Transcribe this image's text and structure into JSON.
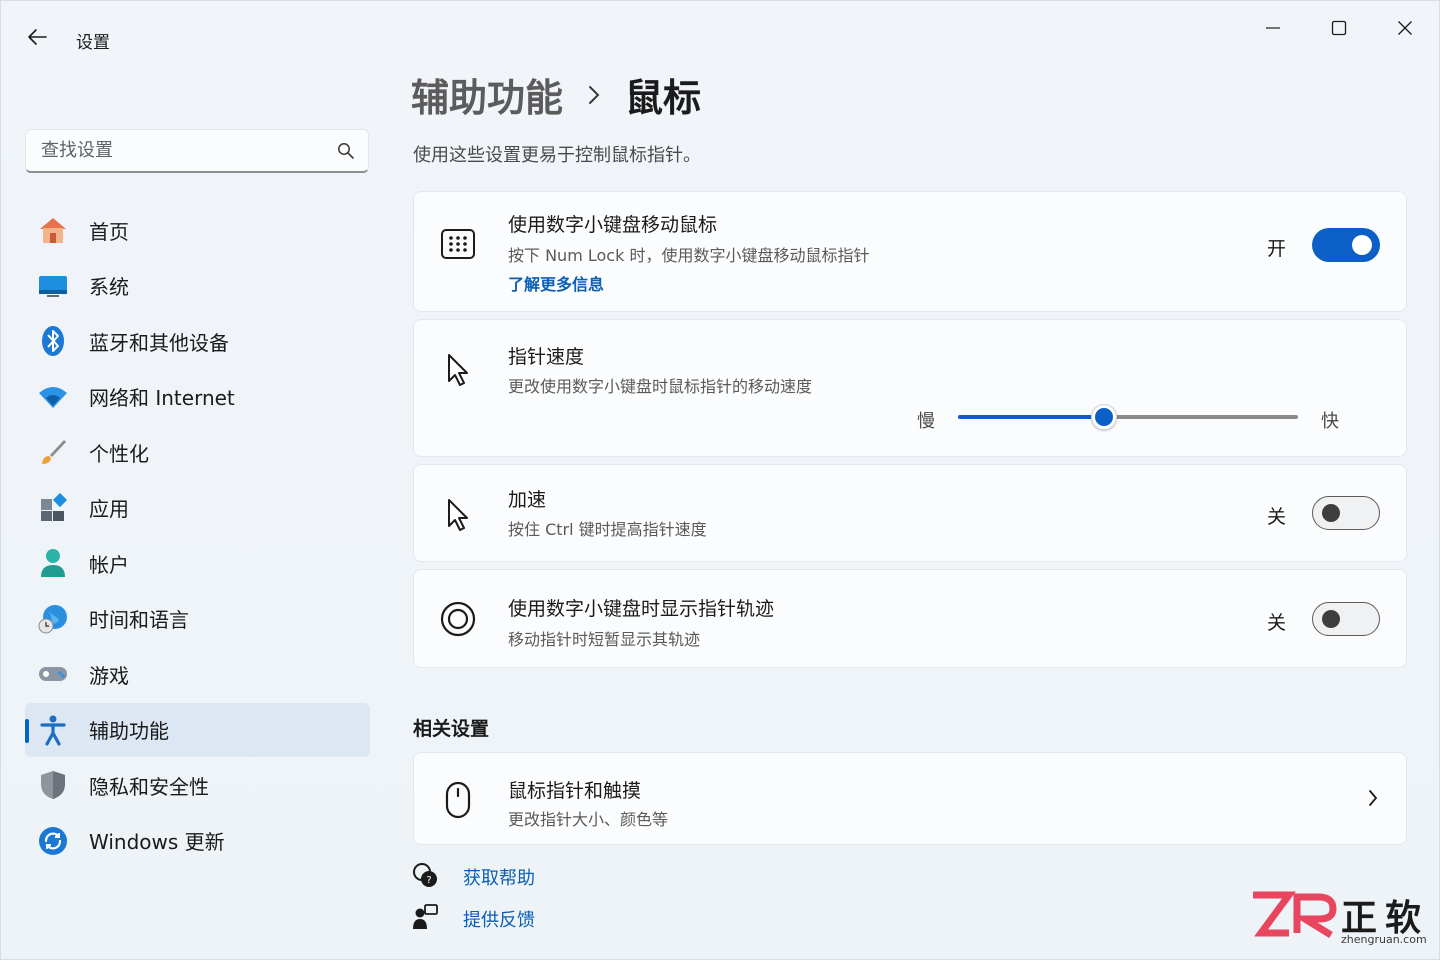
{
  "window": {
    "title": "设置"
  },
  "search": {
    "placeholder": "查找设置"
  },
  "sidebar": {
    "items": [
      {
        "label": "首页",
        "icon": "home-icon",
        "active": false
      },
      {
        "label": "系统",
        "icon": "system-icon",
        "active": false
      },
      {
        "label": "蓝牙和其他设备",
        "icon": "bluetooth-icon",
        "active": false
      },
      {
        "label": "网络和 Internet",
        "icon": "wifi-icon",
        "active": false
      },
      {
        "label": "个性化",
        "icon": "brush-icon",
        "active": false
      },
      {
        "label": "应用",
        "icon": "apps-icon",
        "active": false
      },
      {
        "label": "帐户",
        "icon": "account-icon",
        "active": false
      },
      {
        "label": "时间和语言",
        "icon": "globe-clock-icon",
        "active": false
      },
      {
        "label": "游戏",
        "icon": "gamepad-icon",
        "active": false
      },
      {
        "label": "辅助功能",
        "icon": "accessibility-icon",
        "active": true
      },
      {
        "label": "隐私和安全性",
        "icon": "shield-icon",
        "active": false
      },
      {
        "label": "Windows 更新",
        "icon": "update-icon",
        "active": false
      }
    ]
  },
  "header": {
    "parent": "辅助功能",
    "current": "鼠标",
    "description": "使用这些设置更易于控制鼠标指针。"
  },
  "settings": {
    "numpad": {
      "title": "使用数字小键盘移动鼠标",
      "description": "按下 Num Lock 时，使用数字小键盘移动鼠标指针",
      "link": "了解更多信息",
      "state": "开",
      "on": true
    },
    "speed": {
      "title": "指针速度",
      "description": "更改使用数字小键盘时鼠标指针的移动速度",
      "slow": "慢",
      "fast": "快",
      "value": 0.43
    },
    "acceleration": {
      "title": "加速",
      "description": "按住 Ctrl 键时提高指针速度",
      "state": "关",
      "on": false
    },
    "trails": {
      "title": "使用数字小键盘时显示指针轨迹",
      "description": "移动指针时短暂显示其轨迹",
      "state": "关",
      "on": false
    }
  },
  "related": {
    "title": "相关设置",
    "item": {
      "title": "鼠标指针和触摸",
      "description": "更改指针大小、颜色等"
    }
  },
  "footer": {
    "help": "获取帮助",
    "feedback": "提供反馈"
  },
  "watermark": {
    "brand_cn": "正软",
    "brand_en": "zhengruan.com"
  },
  "colors": {
    "accent": "#0b5fc6",
    "link": "#0b5fb5"
  }
}
